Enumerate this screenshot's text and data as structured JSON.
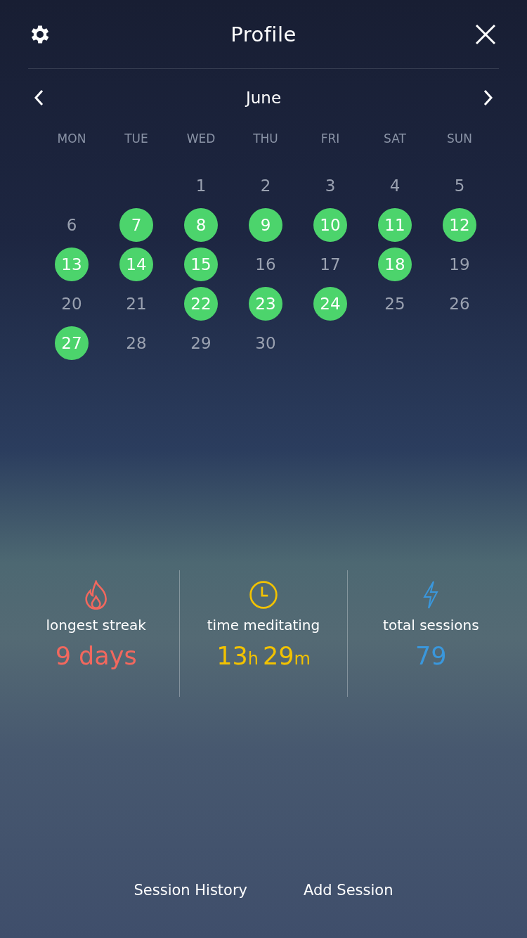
{
  "header": {
    "title": "Profile"
  },
  "calendar": {
    "month": "June",
    "weekdays": [
      "MON",
      "TUE",
      "WED",
      "THU",
      "FRI",
      "SAT",
      "SUN"
    ],
    "weeks": [
      {
        "days": [
          {
            "day": "1",
            "done": false
          },
          {
            "day": "2",
            "done": false
          },
          {
            "day": "3",
            "done": false
          },
          {
            "day": "4",
            "done": false
          },
          {
            "day": "5",
            "done": false
          }
        ]
      },
      {
        "days": [
          {
            "day": "6",
            "done": false
          },
          {
            "day": "7",
            "done": true
          },
          {
            "day": "8",
            "done": true
          },
          {
            "day": "9",
            "done": true
          },
          {
            "day": "10",
            "done": true
          },
          {
            "day": "11",
            "done": true
          },
          {
            "day": "12",
            "done": true
          }
        ]
      },
      {
        "days": [
          {
            "day": "13",
            "done": true
          },
          {
            "day": "14",
            "done": true
          },
          {
            "day": "15",
            "done": true
          },
          {
            "day": "16",
            "done": false
          },
          {
            "day": "17",
            "done": false
          },
          {
            "day": "18",
            "done": true
          },
          {
            "day": "19",
            "done": false
          }
        ]
      },
      {
        "days": [
          {
            "day": "20",
            "done": false
          },
          {
            "day": "21",
            "done": false
          },
          {
            "day": "22",
            "done": true
          },
          {
            "day": "23",
            "done": true
          },
          {
            "day": "24",
            "done": true
          },
          {
            "day": "25",
            "done": false
          },
          {
            "day": "26",
            "done": false
          }
        ]
      },
      {
        "days": [
          {
            "day": "27",
            "done": true
          },
          {
            "day": "28",
            "done": false
          },
          {
            "day": "29",
            "done": false
          },
          {
            "day": "30",
            "done": false
          }
        ]
      }
    ]
  },
  "stats": [
    {
      "kind": "flame",
      "label": "longest streak",
      "color": "#f2685e",
      "value": [
        {
          "text": "9 days",
          "kind": "number"
        }
      ]
    },
    {
      "kind": "clock",
      "label": "time meditating",
      "color": "#f2c200",
      "value": [
        {
          "text": "13",
          "kind": "number"
        },
        {
          "text": "h",
          "kind": "unit"
        },
        {
          "text": "29",
          "kind": "number"
        },
        {
          "text": "m",
          "kind": "unit"
        }
      ]
    },
    {
      "kind": "bolt",
      "label": "total sessions",
      "color": "#3a97dc",
      "value": [
        {
          "text": "79",
          "kind": "number"
        }
      ]
    }
  ],
  "footer": [
    "Session History",
    "Add Session"
  ]
}
